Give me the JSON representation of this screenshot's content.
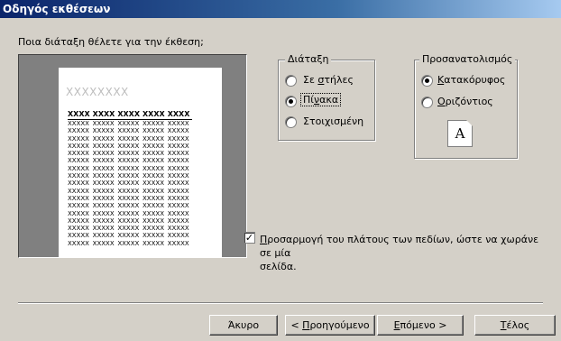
{
  "window": {
    "title": "Οδηγός εκθέσεων"
  },
  "prompt": "Ποια διάταξη θέλετε για την έκθεση;",
  "preview": {
    "title": "XXXXXXXX",
    "headers": [
      "XXXX",
      "XXXX",
      "XXXX",
      "XXXX",
      "XXXX"
    ],
    "row_cell": "XXXXX",
    "row_count": 17
  },
  "layout_group": {
    "title": "Διάταξη",
    "options": [
      {
        "label": "Σε στήλες",
        "selected": false
      },
      {
        "label": "Πίνακα",
        "selected": true
      },
      {
        "label": "Στοιχισμένη",
        "selected": false
      }
    ]
  },
  "orientation_group": {
    "title": "Προσανατολισμός",
    "options": [
      {
        "label": "Κατακόρυφος",
        "selected": true
      },
      {
        "label": "Οριζόντιος",
        "selected": false
      }
    ],
    "icon_letter": "A"
  },
  "fit_checkbox": {
    "checked": true,
    "line1": "Προσαρμογή του πλάτους των πεδίων, ώστε να χωράνε σε μία",
    "line2": "σελίδα."
  },
  "buttons": {
    "cancel": "Άκυρο",
    "back": "< Προηγούμενο",
    "next": "Επόμενο >",
    "finish": "Τέλος"
  }
}
